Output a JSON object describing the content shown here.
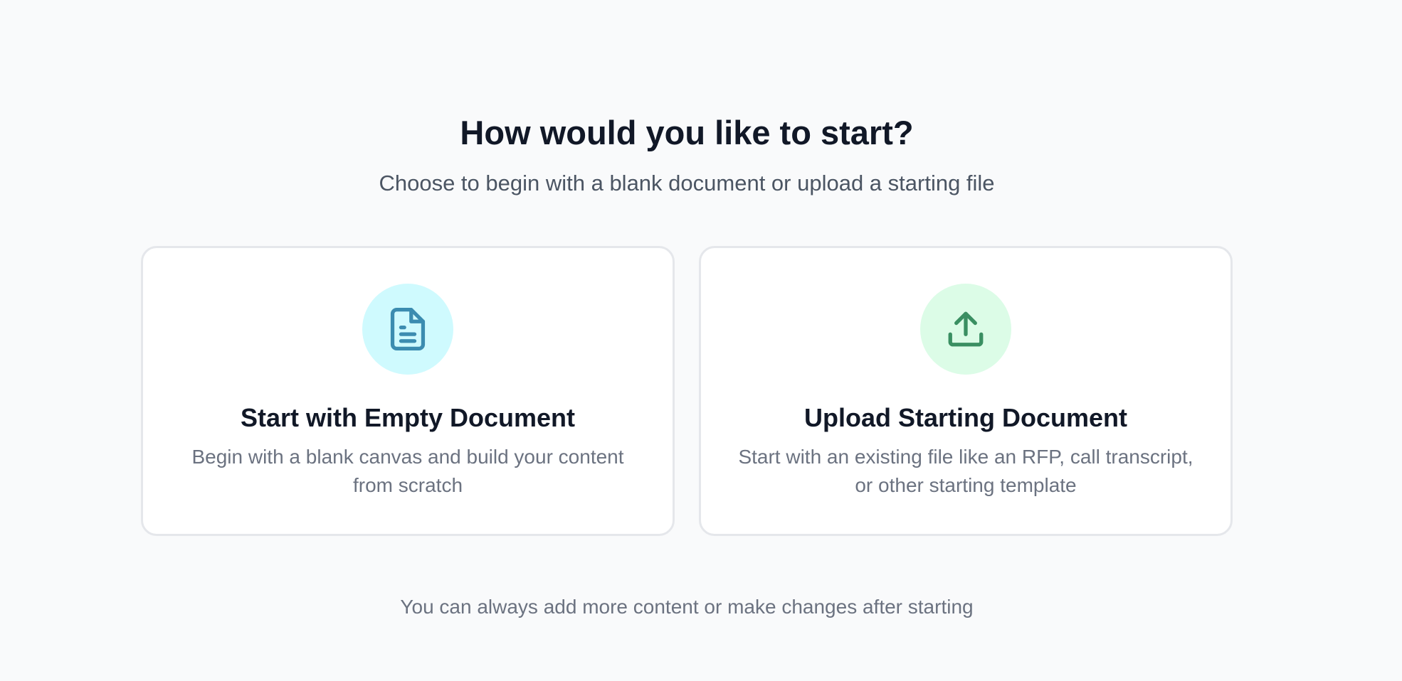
{
  "header": {
    "title": "How would you like to start?",
    "subtitle": "Choose to begin with a blank document or upload a starting file"
  },
  "options": [
    {
      "icon": "document-icon",
      "accent": "#3b8cb0",
      "circle_color": "#cffafe",
      "title": "Start with Empty Document",
      "description": "Begin with a blank canvas and build your content from scratch"
    },
    {
      "icon": "upload-icon",
      "accent": "#3a8f62",
      "circle_color": "#dcfce7",
      "title": "Upload Starting Document",
      "description": "Start with an existing file like an RFP, call transcript, or other starting template"
    }
  ],
  "footer": {
    "note": "You can always add more content or make changes after starting"
  }
}
